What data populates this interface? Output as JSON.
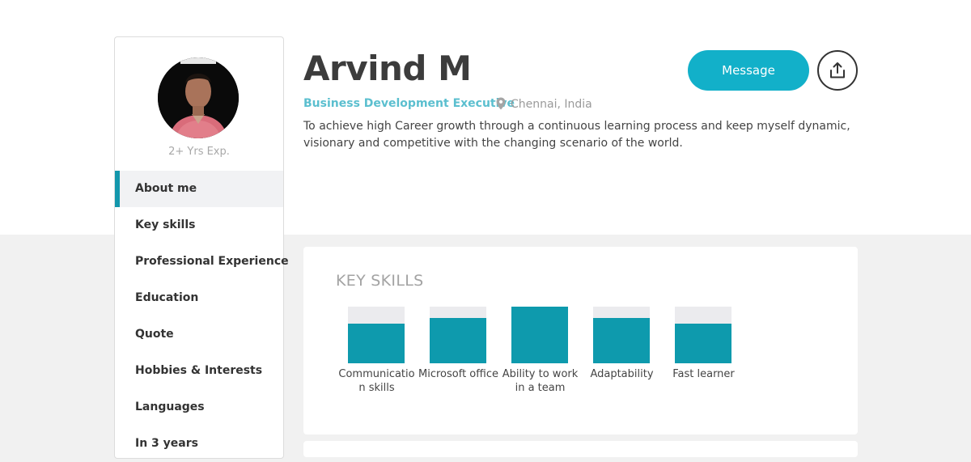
{
  "profile": {
    "name": "Arvind M",
    "experience": "2+ Yrs Exp.",
    "title": "Business Development Executive",
    "location": "Chennai, India",
    "summary": "To achieve high Career growth through a continuous learning process and keep myself dynamic, visionary and competitive with the changing scenario of the world."
  },
  "actions": {
    "message_label": "Message",
    "share_icon": "share-icon"
  },
  "nav": {
    "items": [
      {
        "label": "About me",
        "active": true
      },
      {
        "label": "Key skills"
      },
      {
        "label": "Professional Experience"
      },
      {
        "label": "Education"
      },
      {
        "label": "Quote"
      },
      {
        "label": "Hobbies & Interests"
      },
      {
        "label": "Languages"
      },
      {
        "label": "In 3 years"
      }
    ]
  },
  "skills": {
    "heading": "KEY SKILLS",
    "items": [
      {
        "label": "Communication skills",
        "level": 0.7
      },
      {
        "label": "Microsoft office",
        "level": 0.8
      },
      {
        "label": "Ability to work in a team",
        "level": 1.0
      },
      {
        "label": "Adaptability",
        "level": 0.8
      },
      {
        "label": "Fast learner",
        "level": 0.7
      }
    ]
  },
  "colors": {
    "accent": "#12b0c9",
    "skill_fill": "#0e9aad",
    "title_color": "#5bbfcf"
  }
}
